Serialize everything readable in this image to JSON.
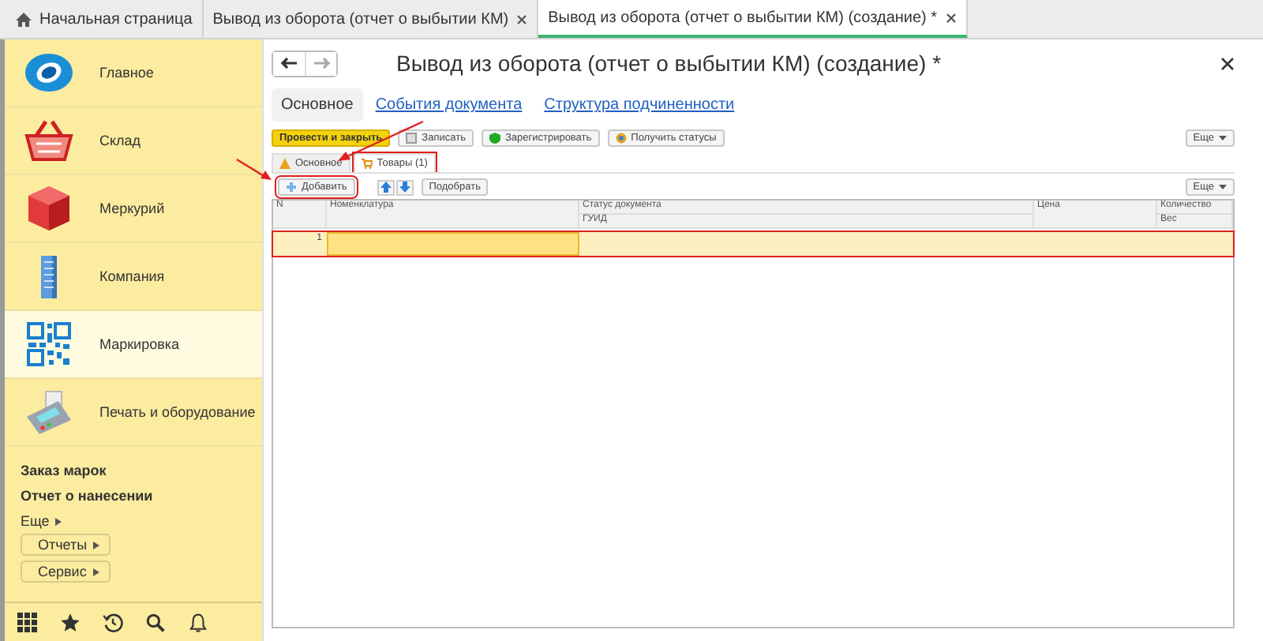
{
  "tabs": [
    {
      "label": "Начальная страница",
      "kind": "home",
      "selected": false
    },
    {
      "label": "Вывод из оборота (отчет о выбытии КМ)",
      "kind": "doc",
      "selected": false
    },
    {
      "label": "Вывод из оборота (отчет о выбытии КМ) (создание) *",
      "kind": "doc",
      "selected": true
    }
  ],
  "sidebar": {
    "sections": [
      {
        "label": "Главное",
        "kind": "globe",
        "selected": false
      },
      {
        "label": "Склад",
        "kind": "basket",
        "selected": false
      },
      {
        "label": "Меркурий",
        "kind": "cube",
        "selected": false
      },
      {
        "label": "Компания",
        "kind": "building",
        "selected": false
      },
      {
        "label": "Маркировка",
        "kind": "qr",
        "selected": true
      },
      {
        "label": "Печать и оборудование",
        "kind": "terminal",
        "selected": false
      }
    ],
    "links": [
      "Заказ марок",
      "Отчет о нанесении"
    ],
    "more": "Еще",
    "groups": [
      "Отчеты",
      "Сервис"
    ]
  },
  "form": {
    "title": "Вывод из оборота (отчет о выбытии КМ) (создание) *",
    "nav_tabs": [
      {
        "label": "Основное",
        "selected": true
      },
      {
        "label": "События документа",
        "selected": false
      },
      {
        "label": "Структура подчиненности",
        "selected": false
      }
    ],
    "buttons": [
      {
        "label": "Провести и закрыть",
        "kind": "primary"
      },
      {
        "label": "Записать",
        "kind": "save"
      },
      {
        "label": "Зарегистрировать",
        "kind": "register"
      },
      {
        "label": "Получить статусы",
        "kind": "status"
      }
    ],
    "more": "Еще",
    "subtabs": [
      {
        "label": "Основное",
        "kind": "warning",
        "selected": false,
        "highlighted": false
      },
      {
        "label": "Товары (1)",
        "kind": "cart",
        "selected": true,
        "highlighted": true
      }
    ],
    "table_toolbar": {
      "add": {
        "label": "Добавить",
        "highlighted": true
      },
      "pick": "Подобрать",
      "more": "Еще"
    },
    "table": {
      "columns": [
        {
          "top": "N"
        },
        {
          "top": "Номенклатура"
        },
        {
          "top": "Статус документа",
          "bottom": "ГУИД"
        },
        {
          "top": "Цена"
        },
        {
          "top": "Количество",
          "bottom": "Вес"
        }
      ],
      "rows": [
        {
          "n": "1",
          "selected": true,
          "highlighted": true
        }
      ]
    }
  }
}
